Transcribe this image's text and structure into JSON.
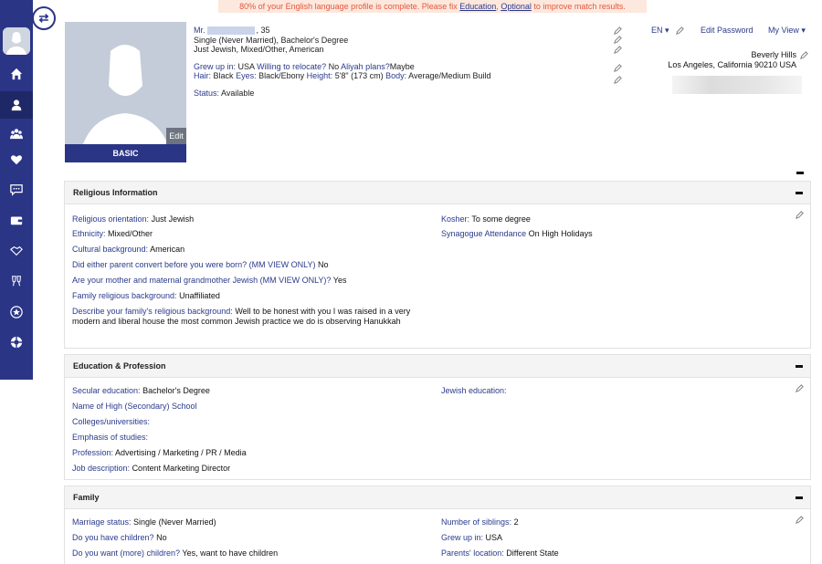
{
  "banner": {
    "prefix": "80% of your English language profile is complete. Please fix",
    "link1": "Education",
    "sep": ",",
    "link2": "Optional",
    "suffix": "to improve match results."
  },
  "photo": {
    "edit_label": "Edit",
    "basic_label": "BASIC"
  },
  "profile": {
    "title": "Mr.",
    "age_suffix": ", 35",
    "line2": "Single (Never Married), Bachelor's Degree",
    "line3": "Just Jewish, Mixed/Other, American",
    "grew_up_label": "Grew up in:",
    "grew_up_value": "USA",
    "relocate_label": "Willing to relocate?",
    "relocate_value": "No",
    "aliyah_label": "Aliyah plans?",
    "aliyah_value": "Maybe",
    "hair_label": "Hair:",
    "hair_value": "Black",
    "eyes_label": "Eyes:",
    "eyes_value": "Black/Ebony",
    "height_label": "Height:",
    "height_value": "5'8\" (173 cm)",
    "body_label": "Body:",
    "body_value": "Average/Medium Build",
    "status_label": "Status:",
    "status_value": "Available"
  },
  "topbar": {
    "lang": "EN",
    "edit_password": "Edit Password",
    "my_view": "My View",
    "city": "Beverly Hills",
    "region": "Los Angeles, California 90210 USA"
  },
  "sections": {
    "religious": {
      "title": "Religious Information",
      "orientation_label": "Religious orientation:",
      "orientation_value": "Just Jewish",
      "ethnicity_label": "Ethnicity:",
      "ethnicity_value": "Mixed/Other",
      "cultural_label": "Cultural background:",
      "cultural_value": "American",
      "convert_label": "Did either parent convert before you were born? (MM VIEW ONLY)",
      "convert_value": "No",
      "mother_label": "Are your mother and maternal grandmother Jewish (MM VIEW ONLY)?",
      "mother_value": "Yes",
      "family_bg_label": "Family religious background:",
      "family_bg_value": "Unaffiliated",
      "describe_label": "Describe your family's religious background:",
      "describe_value": "Well to be honest with you I was raised in a very modern and liberal house the most common Jewish practice we do is observing Hanukkah",
      "kosher_label": "Kosher:",
      "kosher_value": "To some degree",
      "synagogue_label": "Synagogue Attendance",
      "synagogue_value": "On High Holidays"
    },
    "education": {
      "title": "Education & Profession",
      "secular_label": "Secular education:",
      "secular_value": "Bachelor's Degree",
      "highschool_label": "Name of High (Secondary) School",
      "colleges_label": "Colleges/universities:",
      "emphasis_label": "Emphasis of studies:",
      "profession_label": "Profession:",
      "profession_value": "Advertising / Marketing / PR / Media",
      "job_label": "Job description:",
      "job_value": "Content Marketing Director",
      "jewish_edu_label": "Jewish education:"
    },
    "family": {
      "title": "Family",
      "marriage_label": "Marriage status:",
      "marriage_value": "Single (Never Married)",
      "children_label": "Do you have children?",
      "children_value": "No",
      "want_label": "Do you want (more) children?",
      "want_value": "Yes, want to have children",
      "siblings_label": "Number of siblings:",
      "siblings_value": "2",
      "grew_label": "Grew up in:",
      "grew_value": "USA",
      "parents_label": "Parents' location:",
      "parents_value": "Different State"
    }
  },
  "icons": {
    "toggle": "swap-icon",
    "nav": [
      "home-icon",
      "person-icon",
      "group-icon",
      "heart-icon",
      "chat-icon",
      "wallet-icon",
      "handshake-icon",
      "toast-icon",
      "star-icon",
      "lifebuoy-icon"
    ]
  }
}
